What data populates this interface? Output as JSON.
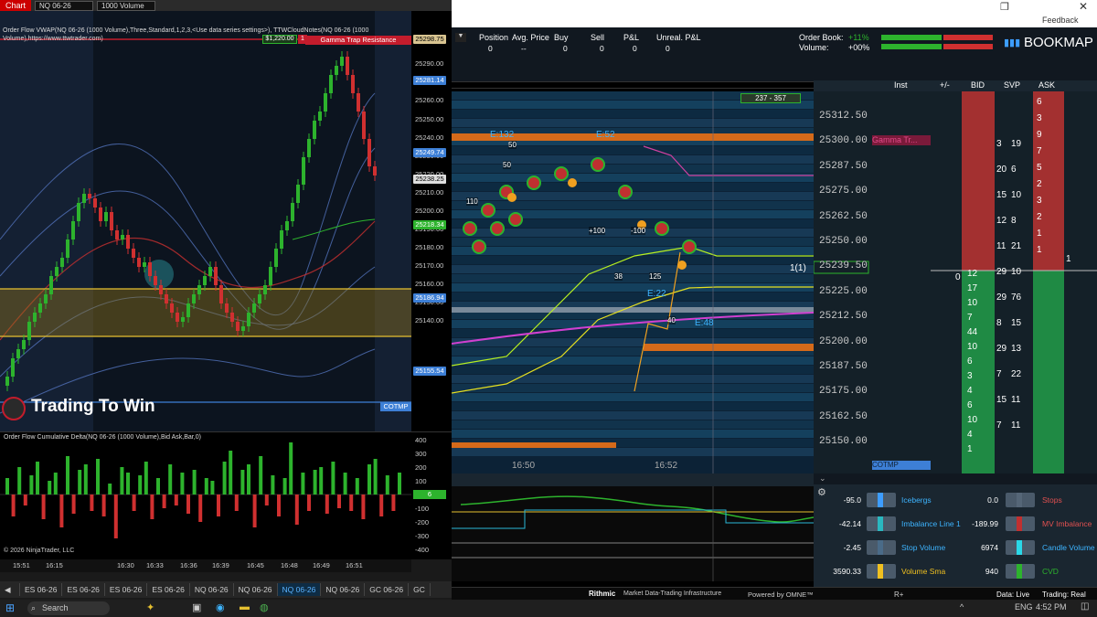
{
  "ninja": {
    "top": {
      "chart_tab": "Chart",
      "instrument": "NQ 06-26",
      "bar_type": "1000 Volume"
    },
    "title": "Order Flow VWAP(NQ 06-26 (1000 Volume),Three,Standard,1,2,3,<Use data series settings>), TTWCloudNotes(NQ 06-26 (1000 Volume),https://www.ttwtrader.com)",
    "delta_title": "Order Flow Cumulative Delta(NQ 06-26 (1000 Volume),Bid Ask,Bar,0)",
    "pnl_tag": "$1,220.00",
    "count_tag": "1",
    "gamma_label": "Gamma Trap Resistance",
    "axis_labels": [
      "25290.00",
      "25270.00",
      "25260.00",
      "25250.00",
      "25240.00",
      "25230.00",
      "25220.00",
      "25210.00",
      "25200.00",
      "25190.00",
      "25180.00",
      "25170.00",
      "25160.00",
      "25150.00",
      "25140.00"
    ],
    "price_tags": [
      {
        "v": "25298.75",
        "c": "#d8c490"
      },
      {
        "v": "25281.14",
        "c": "#3d7fd6"
      },
      {
        "v": "25249.74",
        "c": "#3d7fd6"
      },
      {
        "v": "25238.25",
        "c": "#dddddd"
      },
      {
        "v": "25218.34",
        "c": "#2db32d"
      },
      {
        "v": "25186.94",
        "c": "#3d7fd6"
      },
      {
        "v": "25155.54",
        "c": "#3d7fd6"
      }
    ],
    "cotmp_tag": "COTMP",
    "brand": "Trading To Win",
    "delta_axis": [
      "400",
      "300",
      "200",
      "100",
      "0",
      "-100",
      "-200",
      "-300",
      "-400"
    ],
    "delta_tag": "6",
    "copyright": "© 2026 NinjaTrader, LLC",
    "time_axis": [
      "15:51",
      "16:15",
      "16:30",
      "16:33",
      "16:36",
      "16:39",
      "16:45",
      "16:48",
      "16:49",
      "16:51"
    ],
    "tabs": [
      "ES 06-26",
      "ES 06-26",
      "ES 06-26",
      "ES 06-26",
      "NQ 06-26",
      "NQ 06-26",
      "NQ 06-26",
      "NQ 06-26",
      "GC 06-26",
      "GC"
    ]
  },
  "bookmap": {
    "window": {
      "feedback": "Feedback",
      "restore_icon": "restore-icon",
      "close_icon": "close-icon"
    },
    "position_headers": [
      "Position",
      "Avg. Price",
      "Buy",
      "Sell",
      "P&L",
      "Unreal. P&L"
    ],
    "position_values": [
      "0",
      "--",
      "0",
      "0",
      "0",
      "0"
    ],
    "order_book_label": "Order Book:",
    "order_book_value": "+11%",
    "volume_label": "Volume:",
    "volume_value": "+00%",
    "logo": "BOOKMAP",
    "range_badge": "237 - 357",
    "heat_labels": [
      "E:132",
      "E:52",
      "E:22",
      "E:48",
      "+100",
      "-100",
      "110",
      "50",
      "50",
      "38",
      "125",
      "40"
    ],
    "time_labels": [
      "16:50",
      "16:52"
    ],
    "ladder_headers": [
      "Inst",
      "+/-",
      "BID",
      "SVP",
      "ASK"
    ],
    "ladder_prices": [
      "25312.50",
      "25300.00",
      "25287.50",
      "25275.00",
      "25262.50",
      "25250.00",
      "25239.50",
      "25225.00",
      "25212.50",
      "25200.00",
      "25187.50",
      "25175.00",
      "25162.50",
      "25150.00"
    ],
    "gamma_short": "Gamma Tr...",
    "cotmp": "COTMP",
    "ask_numbers": [
      "6",
      "3",
      "9",
      "7",
      "5",
      "2",
      "3",
      "2",
      "1",
      "1"
    ],
    "bid_numbers": [
      "12",
      "17",
      "10",
      "7",
      "44",
      "10",
      "6",
      "3",
      "4",
      "6",
      "10",
      "4",
      "1"
    ],
    "svp_numbers": [
      "3",
      "19",
      "20",
      "6",
      "15",
      "10",
      "12",
      "8",
      "11",
      "21",
      "29",
      "10",
      "29",
      "76",
      "8",
      "15",
      "29",
      "13",
      "7",
      "22",
      "15",
      "11",
      "7",
      "11"
    ],
    "qty_one": "1",
    "qty_one_b": "1(1)",
    "zero": "0",
    "bid_side": "1",
    "indicators": [
      {
        "v": "-95.0",
        "label": "Icebergs",
        "v2": "0.0",
        "label2": "Stops"
      },
      {
        "v": "-42.14",
        "label": "Imbalance Line 1",
        "v2": "-189.99",
        "label2": "MV Imbalance"
      },
      {
        "v": "-2.45",
        "label": "Stop Volume",
        "v2": "6974",
        "label2": "Candle Volume"
      },
      {
        "v": "3590.33",
        "label": "Volume Sma",
        "v2": "940",
        "label2": "CVD"
      }
    ],
    "footer": {
      "rithmic": "Rithmic",
      "market": "Market Data-Trading Infrastructure",
      "powered": "Powered by OMNE™",
      "r_plus": "R+",
      "data": "Data: Live",
      "trading": "Trading: Real"
    }
  },
  "taskbar": {
    "search": "Search",
    "lang": "ENG",
    "time": "4:52 PM"
  }
}
